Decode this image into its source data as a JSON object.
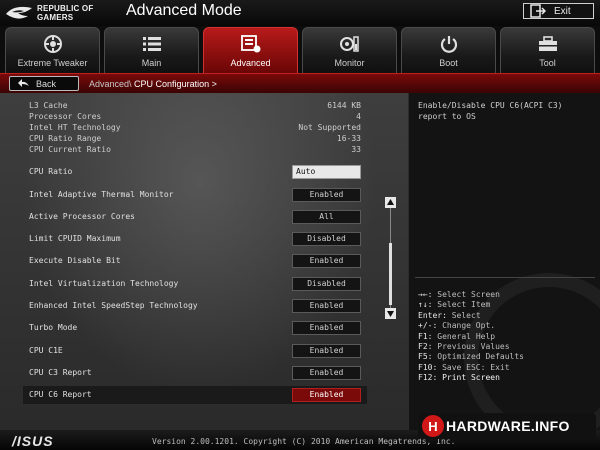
{
  "header": {
    "brand_line1": "REPUBLIC OF",
    "brand_line2": "GAMERS",
    "title": "Advanced Mode",
    "exit_label": "Exit"
  },
  "tabs": [
    {
      "label": "Extreme Tweaker",
      "icon": "tweaker-icon",
      "active": false
    },
    {
      "label": "Main",
      "icon": "list-icon",
      "active": false
    },
    {
      "label": "Advanced",
      "icon": "advanced-icon",
      "active": true
    },
    {
      "label": "Monitor",
      "icon": "monitor-icon",
      "active": false
    },
    {
      "label": "Boot",
      "icon": "power-icon",
      "active": false
    },
    {
      "label": "Tool",
      "icon": "toolbox-icon",
      "active": false
    }
  ],
  "nav": {
    "back_label": "Back",
    "crumb_parent": "Advanced\\",
    "crumb_current": "CPU Configuration >"
  },
  "info": [
    {
      "label": "L3 Cache",
      "value": "6144 KB"
    },
    {
      "label": "Processor Cores",
      "value": "4"
    },
    {
      "label": "Intel HT Technology",
      "value": "Not Supported"
    },
    {
      "label": "CPU Ratio Range",
      "value": "16-33"
    },
    {
      "label": "CPU Current Ratio",
      "value": "33"
    }
  ],
  "options": [
    {
      "label": "CPU Ratio",
      "value": "Auto",
      "input": true
    },
    {
      "label": "Intel Adaptive Thermal Monitor",
      "value": "Enabled"
    },
    {
      "label": "Active Processor Cores",
      "value": "All"
    },
    {
      "label": "Limit CPUID Maximum",
      "value": "Disabled"
    },
    {
      "label": "Execute Disable Bit",
      "value": "Enabled"
    },
    {
      "label": "Intel Virtualization Technology",
      "value": "Disabled"
    },
    {
      "label": "Enhanced Intel SpeedStep Technology",
      "value": "Enabled"
    },
    {
      "label": "Turbo Mode",
      "value": "Enabled"
    },
    {
      "label": "CPU C1E",
      "value": "Enabled"
    },
    {
      "label": "CPU C3 Report",
      "value": "Enabled"
    },
    {
      "label": "CPU C6 Report",
      "value": "Enabled",
      "selected": true
    }
  ],
  "help": {
    "description": "Enable/Disable CPU C6(ACPI C3) report to OS"
  },
  "keys": [
    {
      "key": "→←:",
      "desc": "Select Screen"
    },
    {
      "key": "↑↓:",
      "desc": "Select Item"
    },
    {
      "key": "Enter:",
      "desc": "Select"
    },
    {
      "key": "+/-:",
      "desc": "Change Opt."
    },
    {
      "key": "F1:",
      "desc": "General Help"
    },
    {
      "key": "F2:",
      "desc": "Previous Values"
    },
    {
      "key": "F5:",
      "desc": "Optimized Defaults"
    },
    {
      "key": "F10:",
      "desc": "Save  ESC: Exit"
    },
    {
      "key": "F12:",
      "desc": "Print Screen",
      "highlight": true
    }
  ],
  "footer": {
    "brand": "/ISUS",
    "version": "Version 2.00.1201. Copyright (C) 2010 American Megatrends, Inc."
  },
  "watermark": {
    "badge": "H",
    "text": "HARDWARE.INFO"
  },
  "colors": {
    "accent_red": "#b81a1a",
    "panel_gray": "#3a3a3a",
    "help_bg": "#131313"
  }
}
